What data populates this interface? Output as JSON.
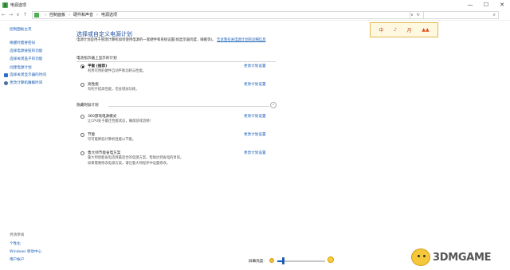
{
  "window": {
    "title": "电源选项",
    "controls": [
      "—",
      "☐",
      "✕"
    ],
    "help": "?"
  },
  "address": {
    "crumbs": [
      "控制面板",
      "硬件和声音",
      "电源选项"
    ],
    "tail": [
      "∨",
      "↻"
    ],
    "search_icon": "search-icon"
  },
  "sidebar": {
    "home": "控制面板主页",
    "links": [
      "唤醒时需要密码",
      "选择电源按钮的功能",
      "选择关闭盖子的功能",
      "创建电源计划"
    ],
    "icon_links": [
      {
        "label": "选择关闭显示器的时间",
        "icon": "monitor-icon",
        "color": "#2e6fc9"
      },
      {
        "label": "更改计算机睡眠时间",
        "icon": "moon-icon",
        "color": "#4a6fa5"
      }
    ],
    "see_also_heading": "另请参阅",
    "see_also": [
      "个性化",
      "Windows 移动中心",
      "用户帐户"
    ]
  },
  "main": {
    "title": "选择或自定义电源计划",
    "desc": "电源计划是用于管理计算机如何使用电源的一套硬件和系统设置(如显示器亮度、睡眠等)。",
    "desc_link": "告诉我有关电源计划的详细信息",
    "section1": "电池指示器上显示的计划",
    "section2": "隐藏附加计划",
    "plans": [
      {
        "name": "平衡 (推荐)",
        "desc1": "利用可用的硬件自动平衡功耗与性能。",
        "desc2": "",
        "checked": true,
        "link": "更改计划设置"
      },
      {
        "name": "高性能",
        "desc1": "有利于提高性能，但会增加功耗。",
        "desc2": "",
        "checked": false,
        "link": "更改计划设置"
      },
      {
        "name": "360游戏电源模式",
        "desc1": "让CPU处于最佳性能状态，确保游戏流畅！",
        "desc2": "",
        "checked": false,
        "link": "更改计划设置"
      },
      {
        "name": "节能",
        "desc1": "尽可能降低计算机性能以节能。",
        "desc2": "",
        "checked": false,
        "link": "更改计划设置"
      },
      {
        "name": "鲁大师节能省电方案",
        "desc1": "鲁大师智能省电选择最适合的电源方案，帮助达到省电的目的。",
        "desc2": "如果需要修改电源方案，请在鲁大师程序中设置修改。",
        "checked": false,
        "link": "更改计划设置"
      }
    ]
  },
  "brightness": {
    "label": "屏幕亮度:",
    "level": 0.12
  },
  "decoration": {
    "chars": [
      "中",
      "♪",
      "月"
    ]
  },
  "watermark": {
    "text": "3DMGAME"
  }
}
